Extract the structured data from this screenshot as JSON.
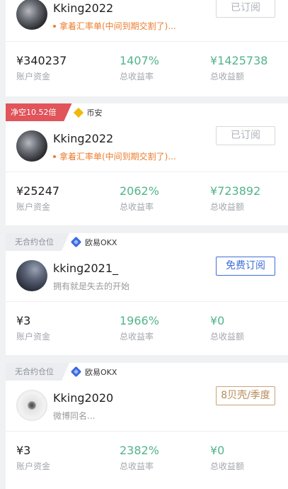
{
  "cards": [
    {
      "tag": "",
      "exchange": "",
      "username": "Kking2022",
      "description": "拿着汇率单(中间到期交割了)...",
      "button": "已订阅",
      "fund": "¥340237",
      "fund_label": "账户资金",
      "yield_rate": "1407%",
      "yield_rate_label": "总收益率",
      "yield_amount": "¥1425738",
      "yield_amount_label": "总收益额"
    },
    {
      "tag": "净空10.52倍",
      "exchange": "币安",
      "username": "Kking2022",
      "description": "拿着汇率单(中间到期交割了)...",
      "button": "已订阅",
      "fund": "¥25247",
      "fund_label": "账户资金",
      "yield_rate": "2062%",
      "yield_rate_label": "总收益率",
      "yield_amount": "¥723892",
      "yield_amount_label": "总收益额"
    },
    {
      "tag": "无合约仓位",
      "exchange": "欧易OKX",
      "username": "kking2021_",
      "description": "拥有就是失去的开始",
      "button": "免费订阅",
      "fund": "¥3",
      "fund_label": "账户资金",
      "yield_rate": "1966%",
      "yield_rate_label": "总收益率",
      "yield_amount": "¥0",
      "yield_amount_label": "总收益额"
    },
    {
      "tag": "无合约仓位",
      "exchange": "欧易OKX",
      "username": "Kking2020",
      "description": "微博同名...",
      "button": "8贝壳/季度",
      "fund": "¥3",
      "fund_label": "账户资金",
      "yield_rate": "2382%",
      "yield_rate_label": "总收益率",
      "yield_amount": "¥0",
      "yield_amount_label": "总收益额"
    }
  ],
  "colors": {
    "accent_blue": "#3f6fd9",
    "green": "#52b48a",
    "orange": "#ec7d2e",
    "tag_red": "#e0545a",
    "gold": "#b78a5b"
  },
  "icons": {
    "binance": "binance-icon",
    "okx": "okx-icon"
  }
}
